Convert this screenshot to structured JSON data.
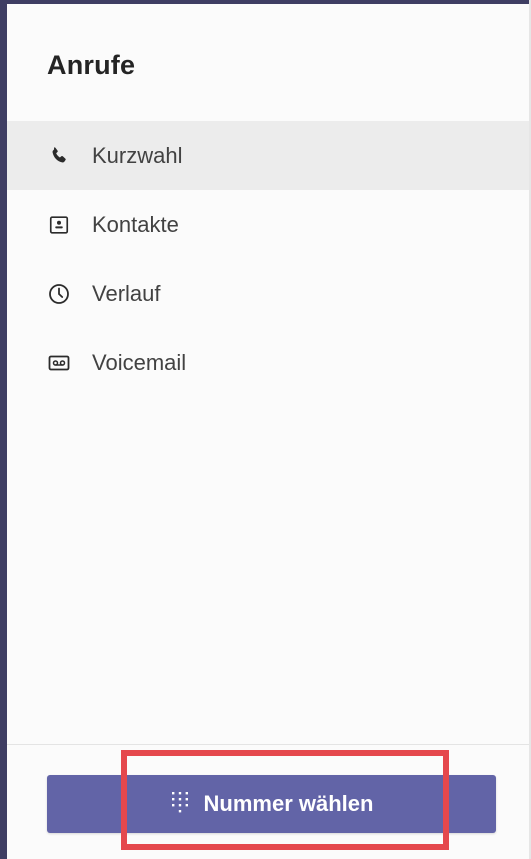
{
  "header": {
    "title": "Anrufe"
  },
  "nav": {
    "items": [
      {
        "label": "Kurzwahl",
        "icon": "phone-icon",
        "selected": true
      },
      {
        "label": "Kontakte",
        "icon": "contact-card-icon",
        "selected": false
      },
      {
        "label": "Verlauf",
        "icon": "clock-icon",
        "selected": false
      },
      {
        "label": "Voicemail",
        "icon": "voicemail-icon",
        "selected": false
      }
    ]
  },
  "dial": {
    "label": "Nummer wählen",
    "icon": "dialpad-icon"
  },
  "colors": {
    "accent": "#6264a7",
    "rail": "#3f3e63",
    "selected_bg": "#ececec",
    "highlight": "#e5484d"
  }
}
